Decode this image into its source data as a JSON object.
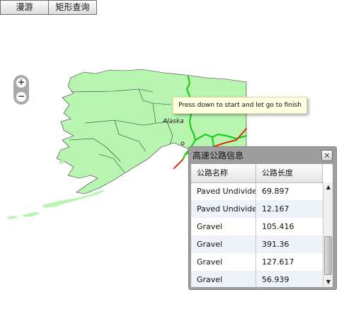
{
  "toolbar": {
    "pan_label": "漫游",
    "rect_query_label": "矩形查询"
  },
  "map": {
    "place_label": "Alaska",
    "tooltip": "Press down to start and let go to finish",
    "zoom_in_label": "+",
    "zoom_out_label": "−",
    "colors": {
      "land": "#b7f5b1",
      "border": "#333333",
      "road_green": "#11cc11",
      "road_red": "#e02a10"
    }
  },
  "panel": {
    "title": "高速公路信息",
    "close_label": "×",
    "columns": [
      "公路名称",
      "公路长度"
    ],
    "rows": [
      {
        "name": "Paved Undivided",
        "length": "69.897"
      },
      {
        "name": "Paved Undivided",
        "length": "12.167"
      },
      {
        "name": "Gravel",
        "length": "105.416"
      },
      {
        "name": "Gravel",
        "length": "391.36"
      },
      {
        "name": "Gravel",
        "length": "127.617"
      },
      {
        "name": "Gravel",
        "length": "56.939"
      }
    ],
    "scroll_up_label": "▲",
    "scroll_down_label": "▼"
  }
}
